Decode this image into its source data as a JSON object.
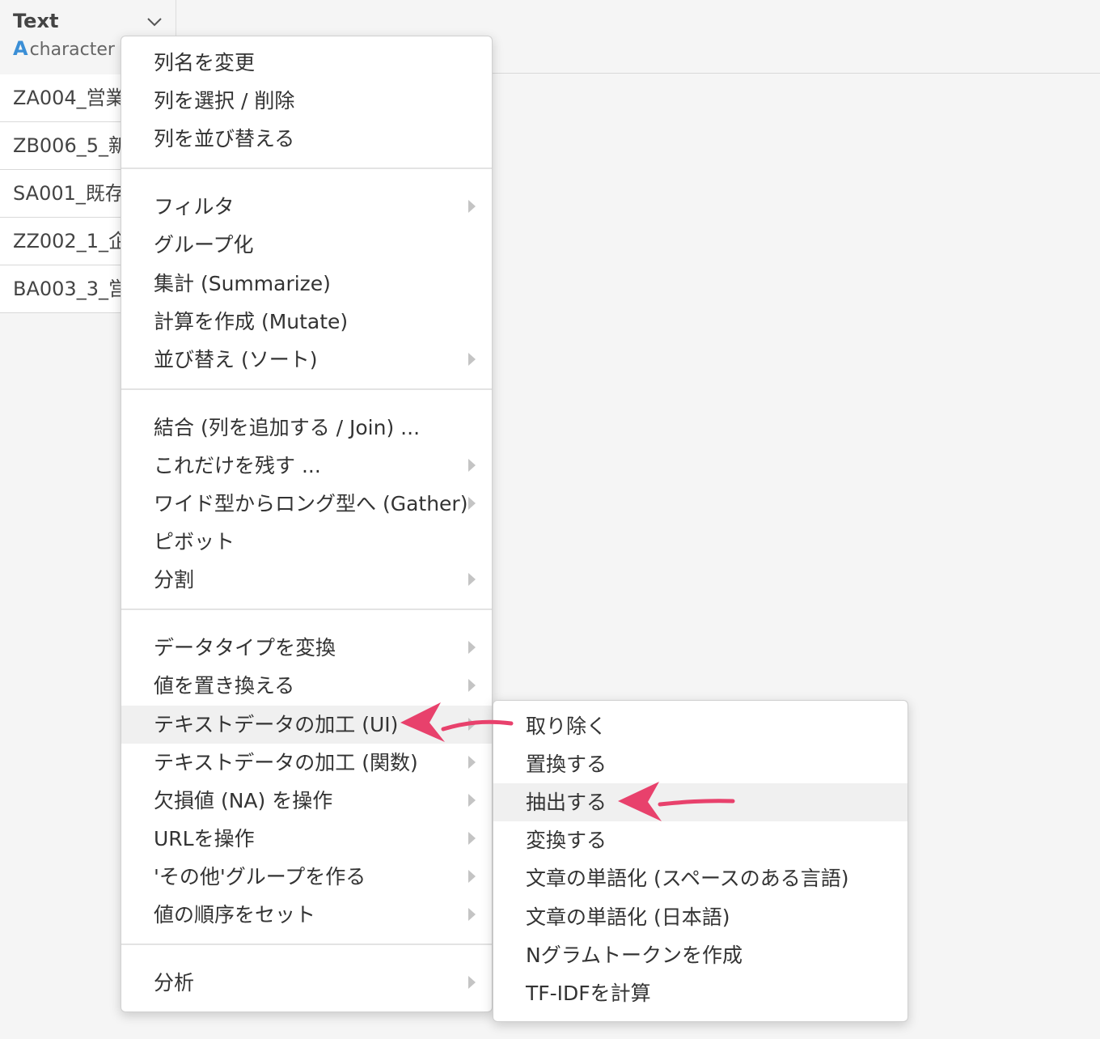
{
  "column": {
    "name": "Text",
    "type_icon": "A",
    "type": "character"
  },
  "rows": [
    "ZA004_営業",
    "ZB006_5_新",
    "SA001_既存",
    "ZZ002_1_企",
    "BA003_3_営"
  ],
  "main_menu": {
    "groups": [
      [
        {
          "label": "列名を変更",
          "has_submenu": false
        },
        {
          "label": "列を選択 / 削除",
          "has_submenu": false
        },
        {
          "label": "列を並び替える",
          "has_submenu": false
        }
      ],
      [
        {
          "label": "フィルタ",
          "has_submenu": true
        },
        {
          "label": "グループ化",
          "has_submenu": false
        },
        {
          "label": "集計 (Summarize)",
          "has_submenu": false
        },
        {
          "label": "計算を作成 (Mutate)",
          "has_submenu": false
        },
        {
          "label": "並び替え (ソート)",
          "has_submenu": true
        }
      ],
      [
        {
          "label": "結合 (列を追加する / Join) ...",
          "has_submenu": false
        },
        {
          "label": "これだけを残す ...",
          "has_submenu": true
        },
        {
          "label": "ワイド型からロング型へ (Gather)",
          "has_submenu": true
        },
        {
          "label": "ピボット",
          "has_submenu": false
        },
        {
          "label": "分割",
          "has_submenu": true
        }
      ],
      [
        {
          "label": "データタイプを変換",
          "has_submenu": true
        },
        {
          "label": "値を置き換える",
          "has_submenu": true
        },
        {
          "label": "テキストデータの加工 (UI)",
          "has_submenu": true,
          "active": true
        },
        {
          "label": "テキストデータの加工 (関数)",
          "has_submenu": true
        },
        {
          "label": "欠損値 (NA) を操作",
          "has_submenu": true
        },
        {
          "label": "URLを操作",
          "has_submenu": true
        },
        {
          "label": "'その他'グループを作る",
          "has_submenu": true
        },
        {
          "label": "値の順序をセット",
          "has_submenu": true
        }
      ],
      [
        {
          "label": "分析",
          "has_submenu": true
        }
      ]
    ]
  },
  "sub_menu": {
    "items": [
      {
        "label": "取り除く"
      },
      {
        "label": "置換する"
      },
      {
        "label": "抽出する",
        "active": true
      },
      {
        "label": "変換する"
      },
      {
        "label": "文章の単語化 (スペースのある言語)"
      },
      {
        "label": "文章の単語化 (日本語)"
      },
      {
        "label": "Nグラムトークンを作成"
      },
      {
        "label": "TF-IDFを計算"
      }
    ]
  },
  "colors": {
    "annotation_arrow": "#e8416c",
    "type_icon": "#3b8fd6",
    "active_item_bg": "#f0f0f0"
  },
  "icons": {
    "column_menu": "chevron-down-icon",
    "submenu": "submenu-arrow-icon",
    "annotation": "pointer-arrow-icon"
  }
}
